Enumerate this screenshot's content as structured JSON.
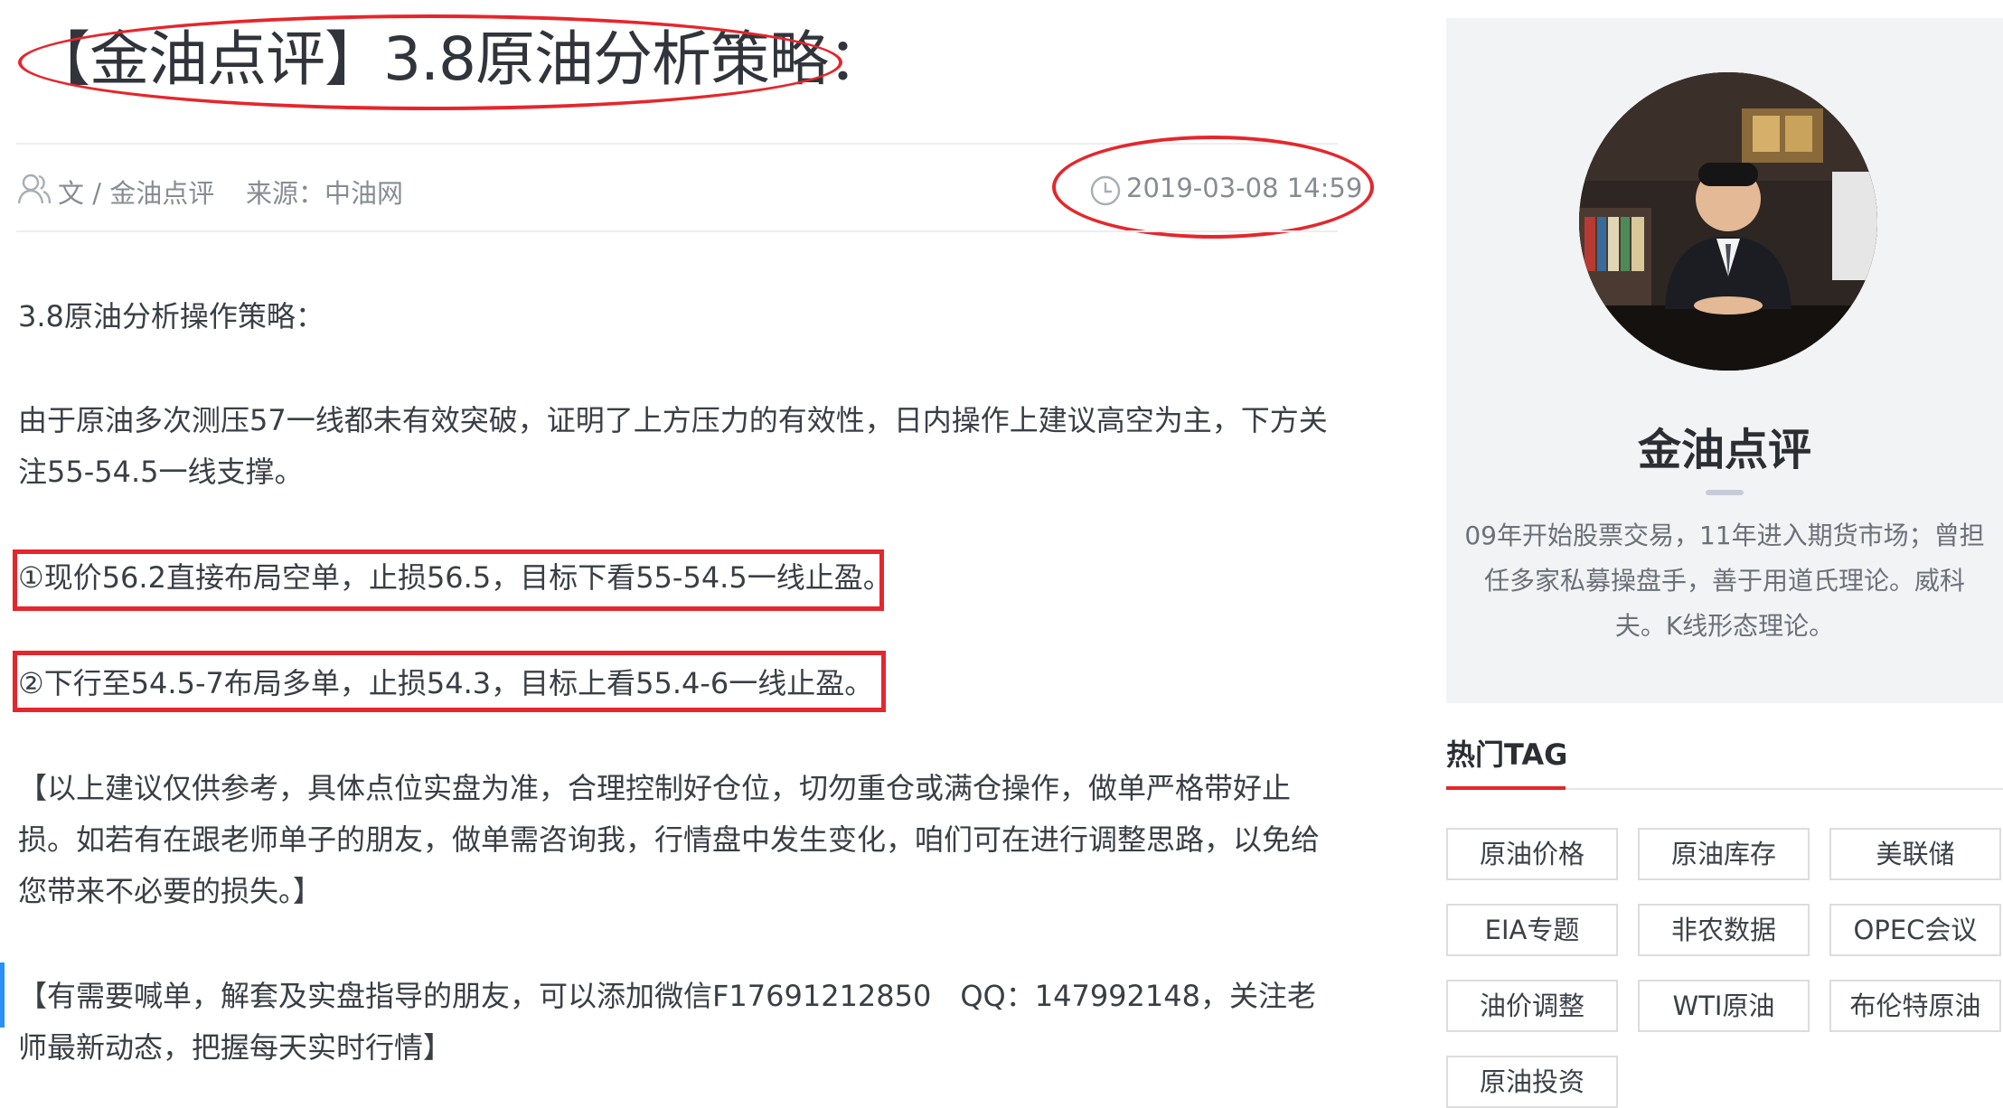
{
  "article": {
    "title": "【金油点评】3.8原油分析策略：",
    "author": "文 / 金油点评",
    "source": "来源：中油网",
    "date": "2019-03-08 14:59",
    "paragraphs": [
      "3.8原油分析操作策略：",
      "由于原油多次测压57一线都未有效突破，证明了上方压力的有效性，日内操作上建议高空为主，下方关注55-54.5一线支撑。",
      "①现价56.2直接布局空单，止损56.5，目标下看55-54.5一线止盈。",
      "②下行至54.5-7布局多单，止损54.3，目标上看55.4-6一线止盈。",
      "【以上建议仅供参考，具体点位实盘为准，合理控制好仓位，切勿重仓或满仓操作，做单严格带好止损。如若有在跟老师单子的朋友，做单需咨询我，行情盘中发生变化，咱们可在进行调整思路，以免给您带来不必要的损失。】",
      "【有需要喊单，解套及实盘指导的朋友，可以添加微信F17691212850　QQ：147992148，关注老师最新动态，把握每天实时行情】"
    ]
  },
  "profile": {
    "name": "金油点评",
    "description": "09年开始股票交易，11年进入期货市场；曾担任多家私募操盘手，善于用道氏理论。威科夫。K线形态理论。"
  },
  "hot_tags": {
    "title": "热门TAG",
    "tags": [
      "原油价格",
      "原油库存",
      "美联储",
      "EIA专题",
      "非农数据",
      "OPEC会议",
      "油价调整",
      "WTI原油",
      "布伦特原油",
      "原油投资"
    ]
  },
  "colors": {
    "annotation_red": "#e5262c",
    "accent_blue": "#2c8ef8",
    "sidebar_bg": "#f2f3f5"
  },
  "icons": [
    "user-icon",
    "clock-icon"
  ]
}
